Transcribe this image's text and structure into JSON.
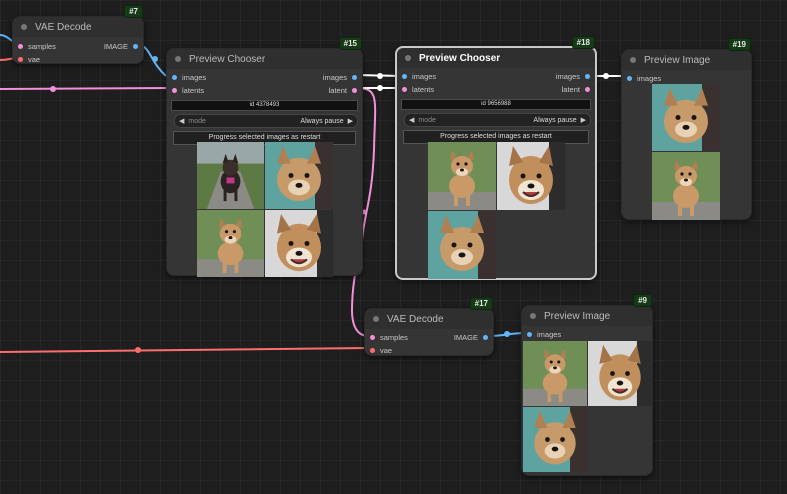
{
  "nodes": {
    "vae_decode_7": {
      "title": "VAE Decode",
      "id": "#7",
      "inputs": [
        "samples",
        "vae"
      ],
      "output": "IMAGE"
    },
    "preview_chooser_15": {
      "title": "Preview Chooser",
      "id": "#15",
      "inputs": [
        "images",
        "latents"
      ],
      "outputs": [
        "images",
        "latent"
      ],
      "seed_label": "id 4378493",
      "mode_label": "mode",
      "mode_value": "Always pause",
      "button_label": "Progress selected images as restart"
    },
    "preview_chooser_18": {
      "title": "Preview Chooser",
      "id": "#18",
      "inputs": [
        "images",
        "latents"
      ],
      "outputs": [
        "images",
        "latent"
      ],
      "seed_label": "id 9656988",
      "mode_label": "mode",
      "mode_value": "Always pause",
      "button_label": "Progress selected images as restart"
    },
    "preview_image_19": {
      "title": "Preview Image",
      "id": "#19",
      "inputs": [
        "images"
      ]
    },
    "vae_decode_17": {
      "title": "VAE Decode",
      "id": "#17",
      "inputs": [
        "samples",
        "vae"
      ],
      "output": "IMAGE"
    },
    "preview_image_9": {
      "title": "Preview Image",
      "id": "#9",
      "inputs": [
        "images"
      ]
    }
  },
  "colors": {
    "image_wire": "#64b5f6",
    "latent_wire": "#f48fda",
    "vae_wire": "#ff6e6e",
    "selected_outline": "#6fdc6f",
    "node_id_badge": "#163a16"
  },
  "icons": {
    "collapse": "collapse-dot-icon",
    "left": "arrow-left-icon",
    "right": "arrow-right-icon"
  }
}
